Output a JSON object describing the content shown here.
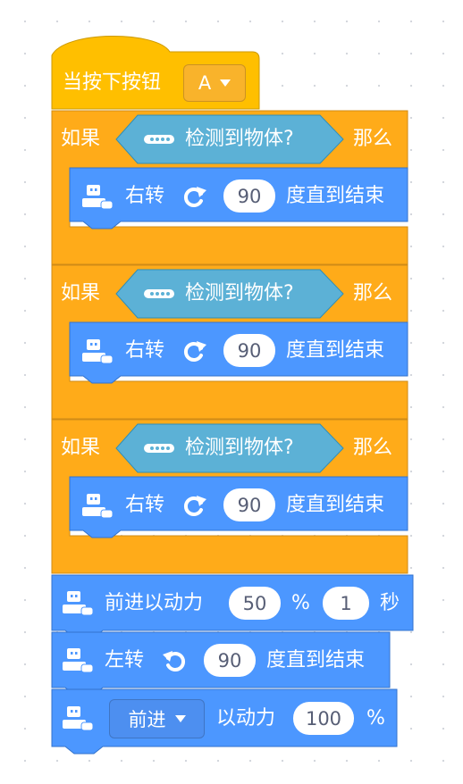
{
  "colors": {
    "event_yellow": "#FFBF00",
    "control_orange": "#FFAB19",
    "motion_blue": "#4C97FF",
    "sensing_cyan": "#5CB1D6"
  },
  "hat": {
    "label": "当按下按钮",
    "button_value": "A"
  },
  "if_blocks": [
    {
      "if_label": "如果",
      "condition": "检测到物体?",
      "then_label": "那么",
      "turn": {
        "label": "右转",
        "value": "90",
        "suffix": "度直到结束"
      }
    },
    {
      "if_label": "如果",
      "condition": "检测到物体?",
      "then_label": "那么",
      "turn": {
        "label": "右转",
        "value": "90",
        "suffix": "度直到结束"
      }
    },
    {
      "if_label": "如果",
      "condition": "检测到物体?",
      "then_label": "那么",
      "turn": {
        "label": "右转",
        "value": "90",
        "suffix": "度直到结束"
      }
    }
  ],
  "forward_block": {
    "label": "前进以动力",
    "power": "50",
    "percent": "%",
    "time": "1",
    "unit": "秒"
  },
  "left_turn": {
    "label": "左转",
    "value": "90",
    "suffix": "度直到结束"
  },
  "move_block": {
    "direction": "前进",
    "label": "以动力",
    "power": "100",
    "percent": "%"
  },
  "icons": {
    "robot": "robot-icon",
    "sensor": "sensor-icon",
    "turn_right": "turn-right-icon",
    "turn_left": "turn-left-icon",
    "caret": "caret-down-icon"
  }
}
